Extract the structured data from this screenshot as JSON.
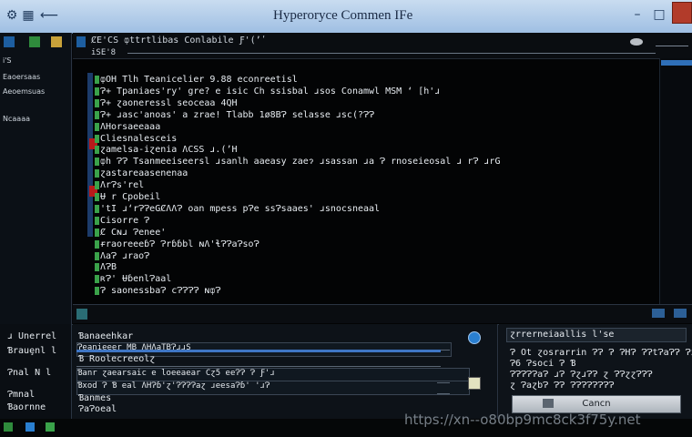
{
  "window": {
    "title": "Hyperoryce Commen IFe",
    "wm_labels": [
      "",
      "",
      ""
    ]
  },
  "toolbar": {
    "path": "ȻE'CS ȹttrtlibas Conlabile Ƒ'(ʼʹ",
    "sub": "iSE'8"
  },
  "left_panel": {
    "items": [
      "i'S",
      "Eaoersaas",
      "Aeoemsuas",
      "Ncaaaa"
    ]
  },
  "terminal": {
    "lines": [
      "ȹOH Tlh Teanicelier 9.88 econreetisl",
      "Ɂ+ Tpaniaes'ry' gre? e isic Ch ssisbal ɹsos Conamwl MSM ʻ [h'ɹ",
      "Ɂ+ ɀaoneressl seoceaa 4QH",
      "Ɂ+ ɹasc'anoas' a zrae! Tlabb 1ø8BɁ selasse ɹsc(?ɁɁ",
      "ɅHorsaeeaaa",
      "Cliesnalesceis",
      "ɀamelsa-iɀenia ɅCSS ɹ.(ʼH",
      "ȹh ɁɁ Tsanmeeiseersl ɹsanlh aaeasy zaeɂ ɹsassan ɹa Ɂ rnoseieosal ɹ rɁ ɹrG",
      "ɀastareaasenenaa",
      "ɅrɁs'rel",
      "Ʉ r Cpobeil",
      "'tI ɹʻrɁɁeGȻɅɅɁ oan mpess pɁe ssɁsaaes' ɹsnocsneaal",
      "Cisorre Ɂ",
      "Ȼ Cɴɹ Ɂenee'",
      "ɍraoreeeɓɁ Ɂrɓɓbl ɴɅ'ɬɁɁaɁsoɁ",
      "ɅaɁ ɹraoɁ",
      "ɅɁB",
      "ʀɁ' ɄɓenlɁaal",
      "Ɂ saonessbaɁ cɁɁɁɁ ɴȹɁ"
    ]
  },
  "dialog_a": {
    "labels": [
      "ɹ Unerrel",
      "Ɓrauȩnl l",
      "Ɂnal N l",
      "Ɂmnal",
      "Ɓaornne"
    ]
  },
  "dialog_b": {
    "fields": [
      "Ɓanaeehkar",
      "Ɂeanieeer MB ɅHɅaTBɁɹɹS",
      "Ɓ Roolecreeolɀ",
      "Ɓanr ɀaearsaic e loeeaear Cɀ5 eeɁɁ Ɂ Ƒ'ɹ",
      "Ɓxod Ɂ Ɓ eal ɅHɁɓ'ɀ'ɁɁɁɁaɀ ɹeesaɁɓ' 'ɹɁ",
      "Ɓanmes",
      "ɁaɁoeal"
    ]
  },
  "dialog_c": {
    "title": "ɀrrerneiaallis l'se",
    "lines": [
      "Ɂ Ot ɀosrarrin ɁɁ Ɂ ɁHɁ ɁɁtɁaɁɁ Ɂɀ",
      "Ɂ6 Ɂsoci Ɂ Ɓ",
      "ɁɁɁɁɁaɁ ɹɁ ɁɀɹɁɁ ɀ ɁɁɀɀɁɁɁ",
      "ɀ ɁaɀbɁ ɁɁ ɁɁɁɁɁɁɁɁ"
    ],
    "cancel_label": "Cancn"
  },
  "watermark": "https://xn--o80bp9mc8ck3f75y.net",
  "colors": {
    "accent": "#2f6fb8",
    "titlebar": "#b6cfe9",
    "green": "#3aa24a",
    "red": "#b81b1b"
  }
}
